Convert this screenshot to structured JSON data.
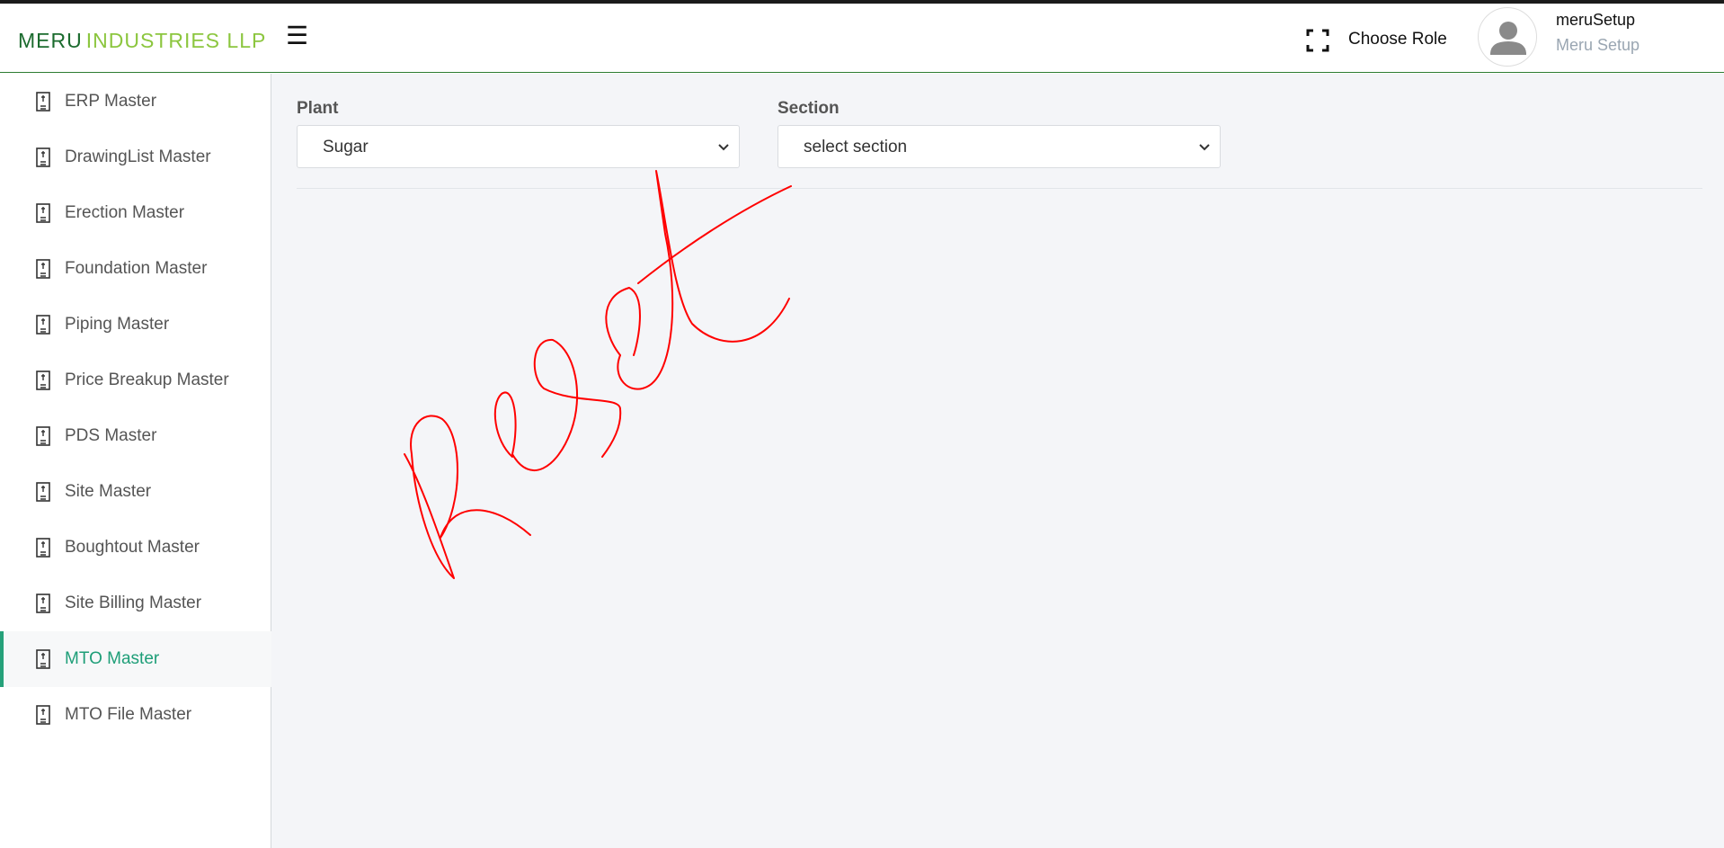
{
  "brand": {
    "name_part1": "MERU",
    "name_part2": "INDUSTRIES LLP"
  },
  "header": {
    "menu_icon": "☰",
    "choose_role_label": "Choose Role",
    "user_name": "meruSetup",
    "user_role": "Meru Setup"
  },
  "sidebar": {
    "items": [
      {
        "label": "ERP Master"
      },
      {
        "label": "DrawingList Master"
      },
      {
        "label": "Erection Master"
      },
      {
        "label": "Foundation Master"
      },
      {
        "label": "Piping Master"
      },
      {
        "label": "Price Breakup Master"
      },
      {
        "label": "PDS Master"
      },
      {
        "label": "Site Master"
      },
      {
        "label": "Boughtout Master"
      },
      {
        "label": "Site Billing Master"
      },
      {
        "label": "MTO Master"
      },
      {
        "label": "MTO File Master"
      }
    ],
    "active_item": "MTO Master"
  },
  "filters": {
    "plant_label": "Plant",
    "plant_value": "Sugar",
    "section_label": "Section",
    "section_value": "select section"
  },
  "colors": {
    "brand_dark": "#1b6b2e",
    "brand_light": "#8cc63f",
    "active": "#1e9e78",
    "annotation": "#ff0000"
  }
}
